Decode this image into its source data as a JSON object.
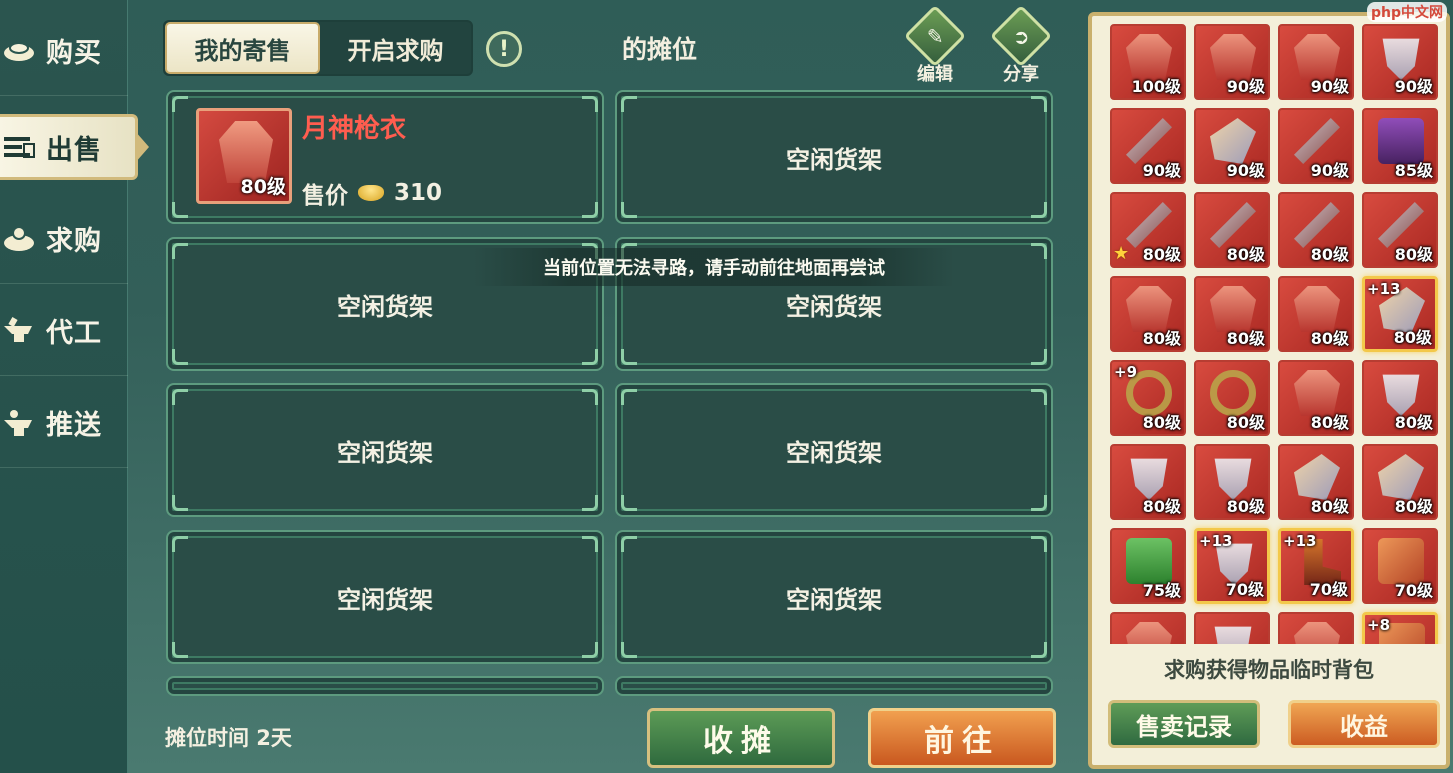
{
  "nav": {
    "items": [
      {
        "label": "购买",
        "icon": "ingot-bowl-icon"
      },
      {
        "label": "出售",
        "icon": "sell-list-icon"
      },
      {
        "label": "求购",
        "icon": "request-bowl-icon"
      },
      {
        "label": "代工",
        "icon": "anvil-icon"
      },
      {
        "label": "推送",
        "icon": "push-anvil-icon"
      }
    ],
    "active_index": 1
  },
  "tabs": [
    {
      "label": "我的寄售",
      "active": true
    },
    {
      "label": "开启求购",
      "active": false
    }
  ],
  "info_icon": "!",
  "stall_title": "的摊位",
  "actions": {
    "edit": {
      "label": "编辑",
      "icon": "edit-icon"
    },
    "share": {
      "label": "分享",
      "icon": "share-icon"
    }
  },
  "listed_item": {
    "name": "月神枪衣",
    "level": "80级",
    "price_label": "售价",
    "price": "310"
  },
  "empty_shelf_label": "空闲货架",
  "toast": "当前位置无法寻路，请手动前往地面再尝试",
  "stall_time": "摊位时间 2天",
  "buttons": {
    "close_stall": "收摊",
    "go_to": "前往"
  },
  "inventory": {
    "slots": [
      {
        "art": "robe",
        "lv": "100级"
      },
      {
        "art": "robe",
        "lv": "90级"
      },
      {
        "art": "robe",
        "lv": "90级"
      },
      {
        "art": "silver",
        "lv": "90级"
      },
      {
        "art": "bow",
        "lv": "90级"
      },
      {
        "art": "glove",
        "lv": "90级"
      },
      {
        "art": "bow",
        "lv": "90级"
      },
      {
        "art": "purple",
        "lv": "85级"
      },
      {
        "art": "bow",
        "lv": "80级",
        "star": true
      },
      {
        "art": "bow",
        "lv": "80级"
      },
      {
        "art": "bow",
        "lv": "80级"
      },
      {
        "art": "bow",
        "lv": "80级"
      },
      {
        "art": "robe",
        "lv": "80级"
      },
      {
        "art": "robe",
        "lv": "80级"
      },
      {
        "art": "robe",
        "lv": "80级"
      },
      {
        "art": "glove",
        "lv": "80级",
        "plus": "+13",
        "gold": true
      },
      {
        "art": "ring",
        "lv": "80级",
        "plus": "+9"
      },
      {
        "art": "ring",
        "lv": "80级"
      },
      {
        "art": "robe",
        "lv": "80级"
      },
      {
        "art": "silver",
        "lv": "80级"
      },
      {
        "art": "silver",
        "lv": "80级"
      },
      {
        "art": "silver",
        "lv": "80级"
      },
      {
        "art": "glove",
        "lv": "80级"
      },
      {
        "art": "glove",
        "lv": "80级"
      },
      {
        "art": "green",
        "lv": "75级"
      },
      {
        "art": "silver",
        "lv": "70级",
        "plus": "+13",
        "gold": true
      },
      {
        "art": "boot",
        "lv": "70级",
        "plus": "+13",
        "gold": true
      },
      {
        "art": "orange",
        "lv": "70级"
      },
      {
        "art": "robe",
        "lv": ""
      },
      {
        "art": "silver",
        "lv": ""
      },
      {
        "art": "robe",
        "lv": ""
      },
      {
        "art": "orange",
        "lv": "",
        "plus": "+8",
        "gold": true
      }
    ],
    "caption": "求购获得物品临时背包",
    "sales_record": "售卖记录",
    "earnings": "收益"
  },
  "watermark": "php中文网"
}
